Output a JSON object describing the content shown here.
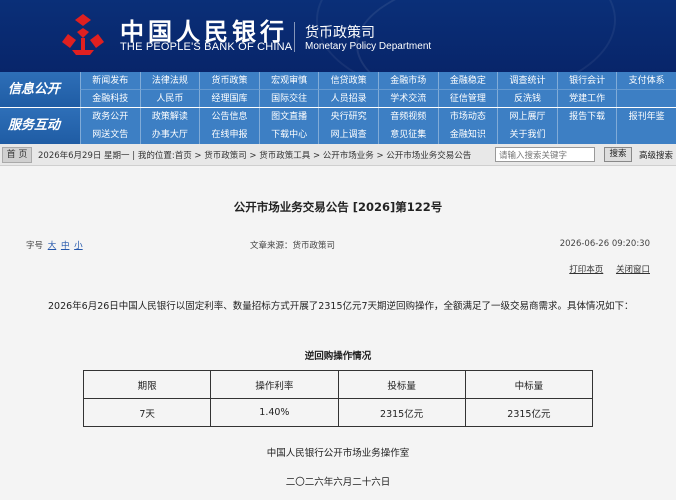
{
  "header": {
    "bank_name_cn": "中国人民银行",
    "bank_name_en": "THE PEOPLE'S BANK OF CHINA",
    "dept_cn": "货币政策司",
    "dept_en": "Monetary Policy Department"
  },
  "nav_info": {
    "label": "信息公开",
    "items": [
      "新闻发布",
      "法律法规",
      "货币政策",
      "宏观审慎",
      "信贷政策",
      "金融市场",
      "金融稳定",
      "调查统计",
      "银行会计",
      "支付体系",
      "金融科技",
      "人民币",
      "经理国库",
      "国际交往",
      "人员招录",
      "学术交流",
      "征信管理",
      "反洗钱",
      "党建工作",
      ""
    ]
  },
  "nav_service": {
    "label": "服务互动",
    "items": [
      "政务公开",
      "政策解读",
      "公告信息",
      "图文直播",
      "央行研究",
      "音频视频",
      "市场动态",
      "网上展厅",
      "报告下载",
      "报刊年鉴",
      "网送文告",
      "办事大厅",
      "在线申报",
      "下载中心",
      "网上调查",
      "意见征集",
      "金融知识",
      "关于我们",
      "",
      ""
    ]
  },
  "breadcrumb": {
    "home": "首 页",
    "text": "2026年6月29日 星期一 | 我的位置:首页 > 货币政策司 > 货币政策工具 > 公开市场业务 > 公开市场业务交易公告",
    "search_placeholder": "请输入搜索关键字",
    "search_button": "搜索",
    "advanced_search": "高级搜索"
  },
  "article": {
    "title": "公开市场业务交易公告 [2026]第122号",
    "font_label": "字号",
    "font_sizes": [
      "大",
      "中",
      "小"
    ],
    "source": "文章来源：货币政策司",
    "datetime": "2026-06-26 09:20:30",
    "print": "打印本页",
    "close": "关闭窗口",
    "paragraph": "2026年6月26日中国人民银行以固定利率、数量招标方式开展了2315亿元7天期逆回购操作，全额满足了一级交易商需求。具体情况如下：",
    "table_title": "逆回购操作情况",
    "table": {
      "headers": [
        "期限",
        "操作利率",
        "投标量",
        "中标量"
      ],
      "rows": [
        [
          "7天",
          "1.40%",
          "2315亿元",
          "2315亿元"
        ]
      ]
    },
    "office": "中国人民银行公开市场业务操作室",
    "date_cn": "二〇二六年六月二十六日"
  },
  "colors": {
    "header_bg": "#0a2f78",
    "nav_bg": "#3d7fc4",
    "logo_red": "#e02020"
  }
}
